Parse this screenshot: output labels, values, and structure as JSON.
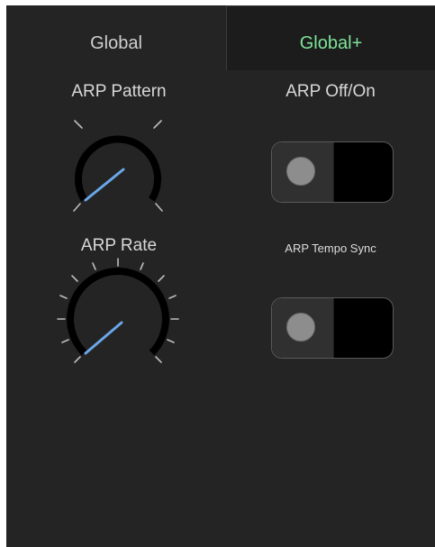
{
  "tabs": {
    "global": {
      "label": "Global",
      "active": false
    },
    "global_plus": {
      "label": "Global+",
      "active": true
    }
  },
  "controls": {
    "arp_pattern": {
      "label": "ARP Pattern",
      "level": 0.05
    },
    "arp_off_on": {
      "label": "ARP Off/On",
      "state": "off"
    },
    "arp_rate": {
      "label": "ARP Rate",
      "level": 0.0
    },
    "arp_tempo_sync": {
      "label": "ARP Tempo Sync",
      "state": "off"
    }
  },
  "colors": {
    "panel_background": "#232423",
    "active_tab_background": "#1b1c1b",
    "active_tab_text": "#7ee39a",
    "inactive_tab_text": "#cfcfcf",
    "knob_arc": "#000000",
    "knob_pointer": "#6aa6e8",
    "tick": "#bdbdbd",
    "toggle_thumb": "#8d8d8d"
  }
}
